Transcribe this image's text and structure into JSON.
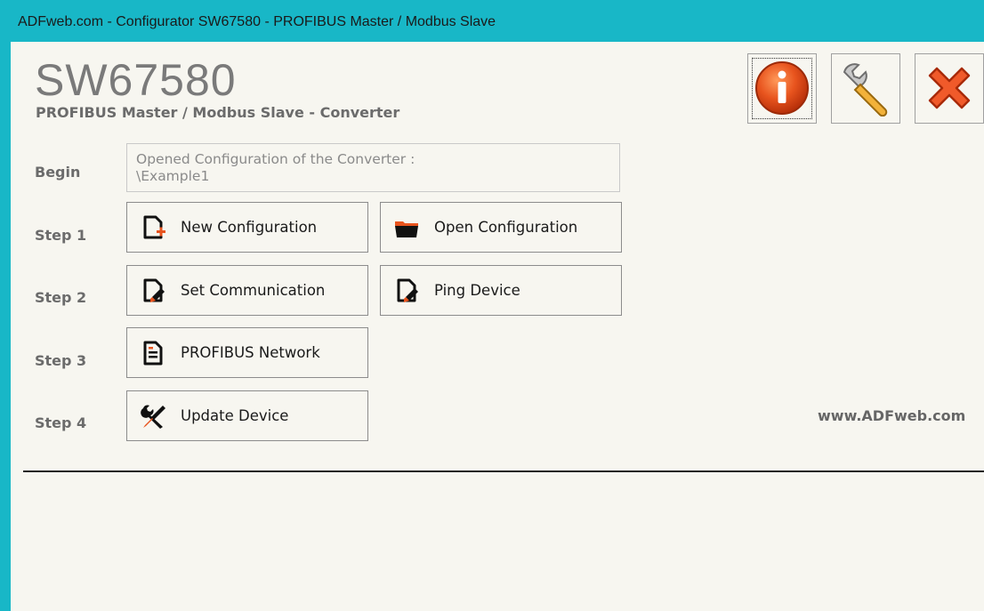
{
  "window": {
    "title": "ADFweb.com - Configurator SW67580 -  PROFIBUS Master /  Modbus Slave"
  },
  "header": {
    "product_code": "SW67580",
    "subtitle": "PROFIBUS Master / Modbus Slave - Converter"
  },
  "toolbar": {
    "info_icon": "info-icon",
    "settings_icon": "wrench-icon",
    "exit_icon": "close-icon"
  },
  "steps": {
    "begin": {
      "label": "Begin",
      "status_line1": "Opened Configuration of the Converter :",
      "status_line2": "\\Example1"
    },
    "step1": {
      "label": "Step 1",
      "new_config": "New Configuration",
      "open_config": "Open Configuration"
    },
    "step2": {
      "label": "Step 2",
      "set_comm": "Set Communication",
      "ping": "Ping Device"
    },
    "step3": {
      "label": "Step 3",
      "profibus": "PROFIBUS Network"
    },
    "step4": {
      "label": "Step 4",
      "update": "Update Device"
    }
  },
  "footer": {
    "website": "www.ADFweb.com"
  },
  "colors": {
    "titlebar": "#18b7c7",
    "background": "#f7f6f0",
    "accent": "#e8541e"
  }
}
